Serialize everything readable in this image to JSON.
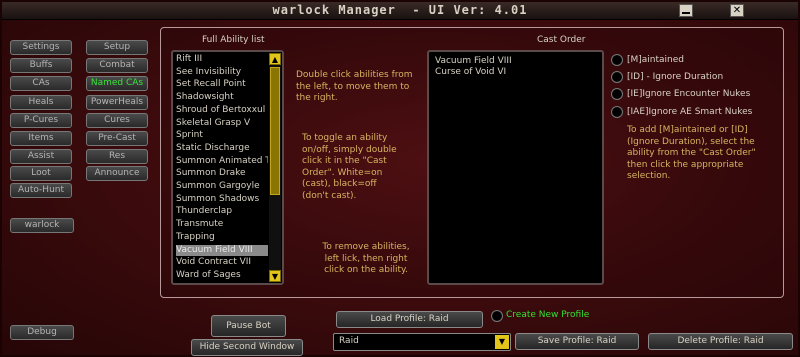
{
  "window": {
    "title": "warlock Manager  - UI Ver: 4.01",
    "minimize_glyph": "",
    "close_glyph": "✕"
  },
  "sidebar": {
    "left_column": [
      "Settings",
      "Buffs",
      "CAs",
      "Heals",
      "P-Cures",
      "Items",
      "Assist",
      "Loot",
      "Auto-Hunt"
    ],
    "right_column": [
      "Setup",
      "Combat",
      "Named CAs",
      "PowerHeals",
      "Cures",
      "Pre-Cast",
      "Res",
      "Announce"
    ],
    "character_button": "warlock",
    "debug_button": "Debug",
    "highlight_color": "#37e237"
  },
  "ability_list": {
    "header": "Full Ability list",
    "items": [
      "Rift III",
      "See Invisibility",
      "Set Recall Point",
      "Shadowsight",
      "Shroud of Bertoxxul",
      "Skeletal Grasp V",
      "Sprint",
      "Static Discharge",
      "Summon Animated T",
      "Summon Drake",
      "Summon Gargoyle",
      "Summon Shadows",
      "Thunderclap",
      "Transmute",
      "Trapping",
      "Vacuum Field VIII",
      "Void Contract VII",
      "Ward of Sages"
    ],
    "selected_index": 15,
    "scroll_up_glyph": "▲",
    "scroll_down_glyph": "▼"
  },
  "help": {
    "move": "Double click abilities from the left, to move them to the right.",
    "toggle": "To toggle an ability on/off, simply double click it in the \"Cast Order\". White=on (cast), black=off (don't cast).",
    "remove": "To remove abilities, left lick, then right click on the ability.",
    "modifiers": "To add [M]aintained or [ID] (Ignore Duration), select the ability from the \"Cast Order\" then click the appropriate selection."
  },
  "cast_order": {
    "header": "Cast Order",
    "items": [
      "Vacuum Field VIII",
      "Curse of Void VI"
    ]
  },
  "options": [
    "[M]aintained",
    "[ID] - Ignore Duration",
    "[IE]Ignore Encounter Nukes",
    "[IAE]Ignore AE Smart Nukes"
  ],
  "bottom": {
    "pause_bot": "Pause Bot",
    "hide_second_window": "Hide Second Window",
    "load_profile": "Load Profile: Raid",
    "create_new_profile": "Create New Profile",
    "profile_value": "Raid",
    "dropdown_glyph": "▼",
    "save_profile": "Save Profile: Raid",
    "delete_profile": "Delete Profile: Raid"
  }
}
